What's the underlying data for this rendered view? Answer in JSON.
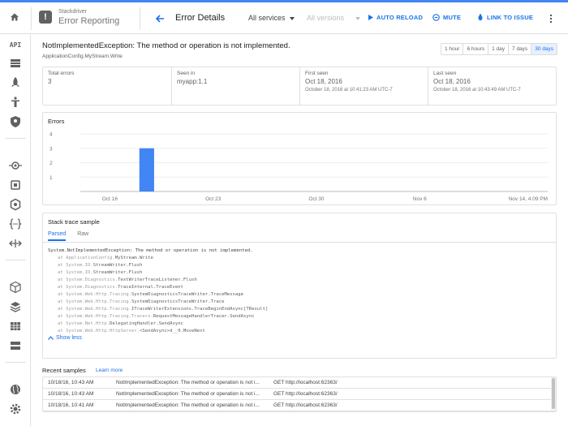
{
  "header": {
    "product_small": "Stackdriver",
    "product_name": "Error Reporting",
    "page_title": "Error Details",
    "services_dropdown": "All services",
    "versions_dropdown": "All versions",
    "auto_reload": "AUTO RELOAD",
    "mute": "MUTE",
    "link_to_issue": "LINK TO ISSUE"
  },
  "sidebar": {
    "api_label": "API",
    "icons": [
      "home-icon",
      "api-icon",
      "storage-icon",
      "rocket-icon",
      "accessibility-icon",
      "security-icon",
      "trace-icon",
      "debug-icon",
      "hexagon-icon",
      "code-brackets-icon",
      "arrows-icon",
      "cube-icon",
      "layers-icon",
      "table-icon",
      "list-icon",
      "world-icon",
      "gear-icon"
    ]
  },
  "error": {
    "title": "NotImplementedException: The method or operation is not implemented.",
    "subtitle": "ApplicationConfig.MyStream.Write"
  },
  "time_ranges": [
    {
      "label": "1 hour",
      "active": false
    },
    {
      "label": "6 hours",
      "active": false
    },
    {
      "label": "1 day",
      "active": false
    },
    {
      "label": "7 days",
      "active": false
    },
    {
      "label": "30 days",
      "active": true
    }
  ],
  "stats": [
    {
      "label": "Total errors",
      "value": "3",
      "detail": ""
    },
    {
      "label": "Seen in",
      "value": "myapp:1.1",
      "detail": ""
    },
    {
      "label": "First seen",
      "value": "Oct 18, 2016",
      "detail": "October 18, 2016 at 10:41:23 AM UTC-7"
    },
    {
      "label": "Last seen",
      "value": "Oct 18, 2016",
      "detail": "October 18, 2016 at 10:43:49 AM UTC-7"
    }
  ],
  "chart_data": {
    "type": "bar",
    "title": "Errors",
    "categories": [
      "Oct 16",
      "Oct 23",
      "Oct 30",
      "Nov 6",
      "Nov 14, 4:09 PM"
    ],
    "bars": [
      {
        "date": "Oct 18",
        "value": 3
      }
    ],
    "yticks": [
      1,
      2,
      3,
      4
    ],
    "ylim": [
      0,
      4
    ],
    "bar_color": "#4285f4"
  },
  "stack_trace": {
    "title": "Stack trace sample",
    "tabs": [
      {
        "label": "Parsed",
        "active": true
      },
      {
        "label": "Raw",
        "active": false
      }
    ],
    "head": "System.NotImplementedException: The method or operation is not implemented.",
    "frames": [
      {
        "ns": "at ApplicationConfig.",
        "fn": "MyStream.Write"
      },
      {
        "ns": "at System.IO.",
        "fn": "StreamWriter.Flush"
      },
      {
        "ns": "at System.IO.",
        "fn": "StreamWriter.Flush"
      },
      {
        "ns": "at System.Diagnostics.",
        "fn": "TextWriterTraceListener.Flush"
      },
      {
        "ns": "at System.Diagnostics.",
        "fn": "TraceInternal.TraceEvent"
      },
      {
        "ns": "at System.Web.Http.Tracing.",
        "fn": "SystemDiagnosticsTraceWriter.TraceMessage"
      },
      {
        "ns": "at System.Web.Http.Tracing.",
        "fn": "SystemDiagnosticsTraceWriter.Trace"
      },
      {
        "ns": "at System.Web.Http.Tracing.",
        "fn": "ITraceWriterExtensions.TraceBeginEndAsync[TResult]"
      },
      {
        "ns": "at System.Web.Http.Tracing.Tracers.",
        "fn": "RequestMessageHandlerTracer.SendAsync"
      },
      {
        "ns": "at System.Net.Http.",
        "fn": "DelegatingHandler.SendAsync"
      },
      {
        "ns": "at System.Web.Http.HttpServer.",
        "fn": "<SendAsync>d__0.MoveNext"
      }
    ],
    "show_less": "Show less"
  },
  "recent_samples": {
    "title": "Recent samples",
    "learn_more": "Learn more",
    "rows": [
      {
        "time": "10/18/16, 10:43 AM",
        "message": "NotImplementedException: The method or operation is not i...",
        "request": "GET http://localhost:62363/"
      },
      {
        "time": "10/18/16, 10:43 AM",
        "message": "NotImplementedException: The method or operation is not i...",
        "request": "GET http://localhost:62363/"
      },
      {
        "time": "10/18/16, 10:41 AM",
        "message": "NotImplementedException: The method or operation is not i...",
        "request": "GET http://localhost:62363/"
      }
    ]
  }
}
